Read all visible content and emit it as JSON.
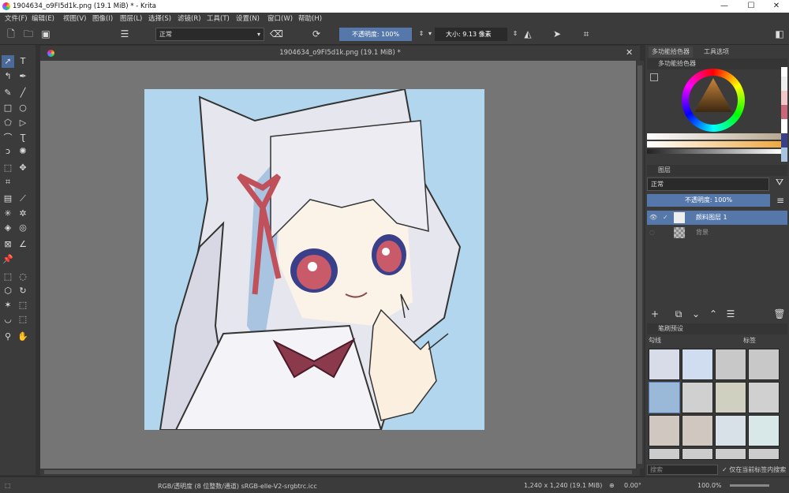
{
  "window": {
    "title": "1904634_o9FI5d1k.png (19.1 MiB) * - Krita",
    "minimize": "—",
    "maximize": "☐",
    "close": "✕"
  },
  "menu": [
    "文件(F)",
    "编辑(E)",
    "视图(V)",
    "图像(I)",
    "图层(L)",
    "选择(S)",
    "滤镜(R)",
    "工具(T)",
    "设置(N)",
    "窗口(W)",
    "帮助(H)"
  ],
  "toolbar": {
    "blend_mode": "正常",
    "opacity": "不透明度: 100%",
    "size": "大小: 9.13 像素"
  },
  "document": {
    "tab_title": "1904634_o9FI5d1k.png (19.1 MiB) *",
    "close": "✕"
  },
  "dock": {
    "tabs": [
      "多功能拾色器",
      "工具选项"
    ],
    "color_panel_title": "多功能拾色器",
    "layers_title": "图层",
    "layer_blend": "正常",
    "layer_opacity": "不透明度: 100%",
    "layers": [
      {
        "name": "颜料图层 1"
      },
      {
        "name": "背景"
      }
    ],
    "presets_title": "笔刷预设",
    "preset_tag": "勾线",
    "tag_label": "标签",
    "search_placeholder": "搜索",
    "search_in_tag": "仅在当前标签内搜索"
  },
  "status": {
    "color_info": "RGB/透明度 (8 位整数/通道)  sRGB-elle-V2-srgbtrc.icc",
    "dimensions": "1,240 x 1,240 (19.1 MiB)",
    "rotation": "0.00°",
    "zoom": "100.0%"
  },
  "colors": {
    "accent": "#5577aa",
    "canvas_bg": "#b2d6ee",
    "dark_bg": "#323232",
    "panel": "#3b3b3b"
  }
}
